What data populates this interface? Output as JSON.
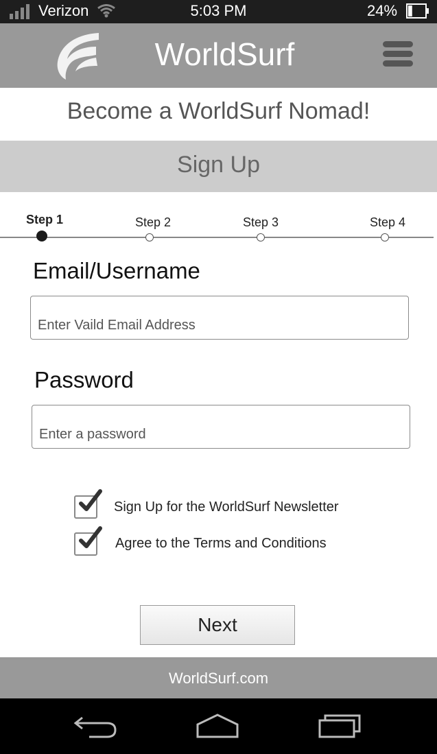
{
  "status_bar": {
    "carrier": "Verizon",
    "time": "5:03 PM",
    "battery_percent": "24%",
    "battery_level": 0.24,
    "icons": [
      "signal-icon",
      "wifi-icon",
      "battery-icon"
    ]
  },
  "header": {
    "app_name": "WorldSurf",
    "icons": [
      "worldsurf-logo-icon",
      "hamburger-menu-icon"
    ]
  },
  "tagline": "Become a WorldSurf Nomad!",
  "section_title": "Sign Up",
  "stepper": {
    "current_step": 1,
    "steps": [
      {
        "label": "Step 1"
      },
      {
        "label": "Step 2"
      },
      {
        "label": "Step 3"
      },
      {
        "label": "Step 4"
      }
    ]
  },
  "form": {
    "email": {
      "label": "Email/Username",
      "placeholder": "Enter Vaild Email Address",
      "value": ""
    },
    "password": {
      "label": "Password",
      "placeholder": "Enter a password",
      "value": ""
    },
    "newsletter": {
      "label": "Sign Up for the WorldSurf Newsletter",
      "checked": true
    },
    "terms": {
      "label": "Agree to the Terms and Conditions",
      "checked": true
    },
    "next_label": "Next"
  },
  "footer": {
    "link": "WorldSurf.com"
  },
  "nav_bar": {
    "icons": [
      "back-icon",
      "home-icon",
      "recent-apps-icon"
    ]
  },
  "colors": {
    "header_bg": "#999999",
    "section_bg": "#cccccc",
    "status_bg": "#1e1e1e",
    "nav_bg": "#000000"
  }
}
